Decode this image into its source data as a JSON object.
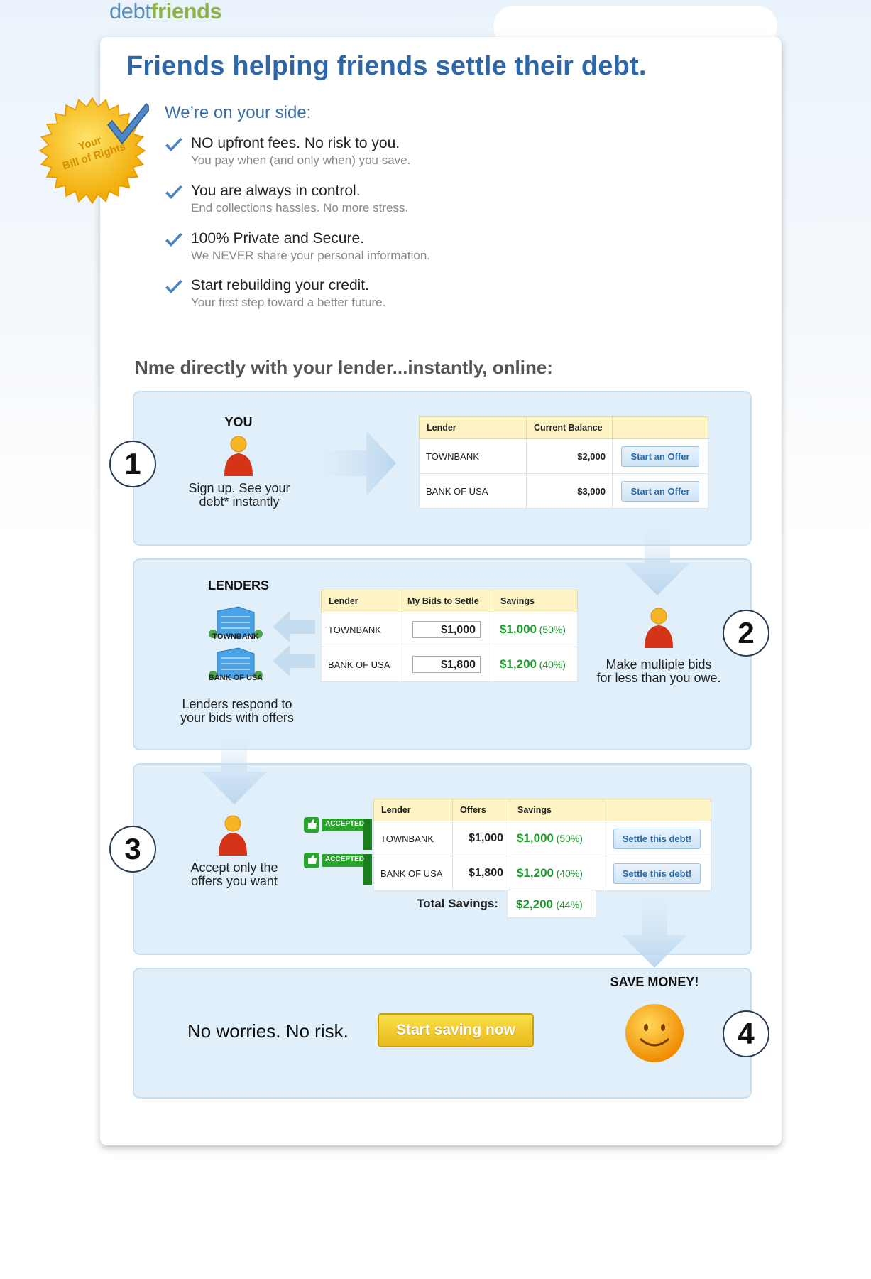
{
  "brand": {
    "part1": "debt",
    "part2": "friends"
  },
  "headline": "Friends helping friends settle their debt.",
  "seal": {
    "line1": "Your",
    "line2": "Bill of Rights"
  },
  "onside": "We’re on your side:",
  "benefits": [
    {
      "title": "NO upfront fees. No risk to you.",
      "sub": "You pay when (and only when) you save."
    },
    {
      "title": "You are always in control.",
      "sub": "End collections hassles. No more stress."
    },
    {
      "title": "100% Private and Secure.",
      "sub": "We NEVER share your personal information."
    },
    {
      "title": "Start rebuilding your credit.",
      "sub": "Your first step toward a better future."
    }
  ],
  "section_title": "Nme directly with your lender...instantly, online:",
  "step1": {
    "number": "1",
    "label": "YOU",
    "caption_l1": "Sign up. See your",
    "caption_l2": "debt* instantly",
    "table": {
      "headers": [
        "Lender",
        "Current Balance",
        ""
      ],
      "rows": [
        {
          "lender": "TOWNBANK",
          "balance": "$2,000",
          "action": "Start an Offer"
        },
        {
          "lender": "BANK OF USA",
          "balance": "$3,000",
          "action": "Start an Offer"
        }
      ]
    }
  },
  "step2": {
    "number": "2",
    "label": "LENDERS",
    "bank1": "TOWNBANK",
    "bank2": "BANK OF USA",
    "left_caption_l1": "Lenders respond to",
    "left_caption_l2": "your bids with offers",
    "right_caption_l1": "Make multiple bids",
    "right_caption_l2": "for less than you owe.",
    "table": {
      "headers": [
        "Lender",
        "My Bids to Settle",
        "Savings"
      ],
      "rows": [
        {
          "lender": "TOWNBANK",
          "bid": "$1,000",
          "savings": "$1,000",
          "pct": "(50%)"
        },
        {
          "lender": "BANK OF USA",
          "bid": "$1,800",
          "savings": "$1,200",
          "pct": "(40%)"
        }
      ]
    }
  },
  "step3": {
    "number": "3",
    "caption_l1": "Accept only the",
    "caption_l2": "offers you want",
    "accepted_label": "ACCEPTED",
    "table": {
      "headers": [
        "Lender",
        "Offers",
        "Savings",
        ""
      ],
      "rows": [
        {
          "lender": "TOWNBANK",
          "offer": "$1,000",
          "savings": "$1,000",
          "pct": "(50%)",
          "action": "Settle this debt!"
        },
        {
          "lender": "BANK OF USA",
          "offer": "$1,800",
          "savings": "$1,200",
          "pct": "(40%)",
          "action": "Settle this debt!"
        }
      ],
      "total_label": "Total Savings:",
      "total_value": "$2,200",
      "total_pct": "(44%)"
    }
  },
  "step4": {
    "number": "4",
    "label": "SAVE MONEY!",
    "tagline": "No worries. No risk.",
    "cta": "Start saving now"
  },
  "colors": {
    "headline": "#2e67a8",
    "panel": "#e1effa",
    "savings_green": "#1c9a2a",
    "cta": "#f2c932"
  }
}
